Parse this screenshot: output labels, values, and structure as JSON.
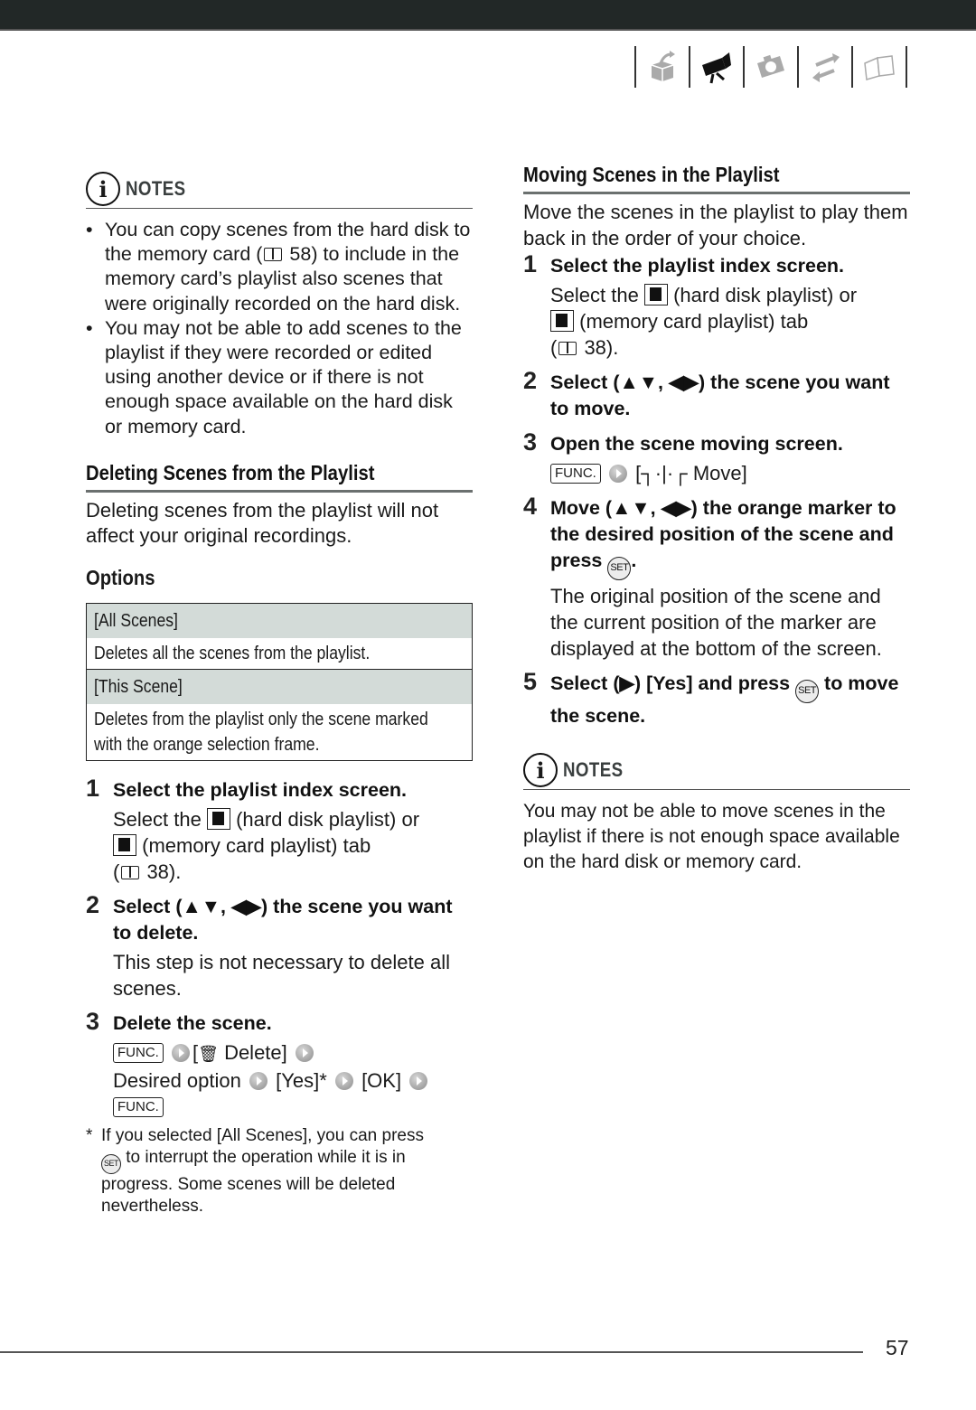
{
  "nav": {
    "tabs": [
      {
        "name": "setup-box-icon",
        "active": false
      },
      {
        "name": "camcorder-icon",
        "active": true
      },
      {
        "name": "camera-icon",
        "active": false
      },
      {
        "name": "transfer-icon",
        "active": false
      },
      {
        "name": "book-icon",
        "active": false
      }
    ]
  },
  "left": {
    "notes": {
      "label": "NOTES",
      "items": [
        "You can copy scenes from the hard disk to the memory card (     58) to include in the memory card’s playlist also scenes that were originally recorded on the hard disk.",
        "You may not be able to add scenes to the playlist if they were recorded or edited using another device or if there is not enough space available on the hard disk or memory card."
      ],
      "item1_parts": {
        "before": "You can copy scenes from the hard disk to the memory card (",
        "ref": "58",
        "after": ") to include in the memory card’s playlist also scenes that were originally recorded on the hard disk."
      }
    },
    "section": {
      "title": "Deleting Scenes from the Playlist",
      "intro": "Deleting scenes from the playlist will not affect your original recordings."
    },
    "options": {
      "title": "Options",
      "rows": [
        {
          "name": "[All Scenes]",
          "desc": "Deletes all the scenes from the playlist."
        },
        {
          "name": "[This Scene]",
          "desc_line1": "Deletes from the playlist only the scene marked",
          "desc_line2": "with the orange selection frame."
        }
      ]
    },
    "steps": [
      {
        "num": "1",
        "title": "Select the playlist index screen.",
        "body_a": "Select the ",
        "body_b": " (hard disk playlist) or",
        "body_c": " (memory card playlist) tab",
        "body_d_open": "(",
        "body_d_ref": " 38)."
      },
      {
        "num": "2",
        "title": "Select (▲▼, ◀▶) the scene you want to delete.",
        "body": "This step is not necessary to delete all scenes."
      },
      {
        "num": "3",
        "title": "Delete the scene.",
        "func": "FUNC.",
        "delete_label": "Delete]",
        "bracket_open": "[",
        "desired_option": "Desired option",
        "yes": "[Yes]*",
        "ok": "[OK]"
      }
    ],
    "footnote": {
      "star": "*",
      "line1": "If you selected [All Scenes], you can press",
      "set": "SET",
      "rest": " to interrupt the operation while it is in progress. Some scenes will be deleted nevertheless."
    }
  },
  "right": {
    "section": {
      "title": "Moving Scenes in the Playlist",
      "intro": "Move the scenes in the playlist to play them back in the order of your choice."
    },
    "steps": [
      {
        "num": "1",
        "title": "Select the playlist index screen.",
        "body_a": "Select the ",
        "body_b": " (hard disk playlist) or",
        "body_c": " (memory card playlist) tab",
        "body_d_open": "(",
        "body_d_ref": " 38)."
      },
      {
        "num": "2",
        "title": "Select (▲▼, ◀▶) the scene you want to move."
      },
      {
        "num": "3",
        "title": "Open the scene moving screen.",
        "func": "FUNC.",
        "move_label": "[┐·|·┌  Move]"
      },
      {
        "num": "4",
        "title_a": "Move (▲▼, ◀▶) the orange marker to the desired position of the scene and press ",
        "title_b": ".",
        "set": "SET",
        "body": "The original position of the scene and the current position of the marker are displayed at the bottom of the screen."
      },
      {
        "num": "5",
        "title_a": "Select (▶) [Yes] and press ",
        "title_b": " to move the scene.",
        "set": "SET"
      }
    ],
    "notes": {
      "label": "NOTES",
      "text": "You may not be able to move scenes in the playlist if there is not enough space available on the hard disk or memory card."
    }
  },
  "footer": {
    "page_number": "57"
  }
}
